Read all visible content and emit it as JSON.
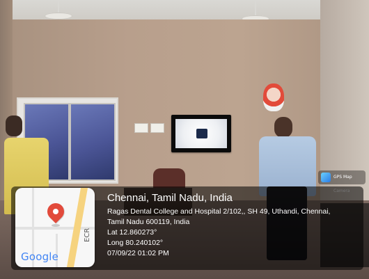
{
  "location": {
    "title": "Chennai, Tamil Nadu, India",
    "address_line_1": "Ragas Dental College and Hospital 2/102,, SH 49, Uthandi, Chennai,",
    "address_line_2": "Tamil Nadu 600119, India",
    "latitude": "Lat 12.860273°",
    "longitude": "Long 80.240102°",
    "datetime": "07/09/22 01:02 PM"
  },
  "map": {
    "logo_text": "Google",
    "road_label": "ECR",
    "icons": {
      "pin": "map-pin-icon"
    }
  },
  "camera_badge": {
    "text": "GPS Map Camera",
    "icon": "camera-app-icon"
  },
  "colors": {
    "pin": "#e24a3b",
    "overlay": "rgba(0,0,0,0.55)",
    "road": "#f6d37f"
  }
}
